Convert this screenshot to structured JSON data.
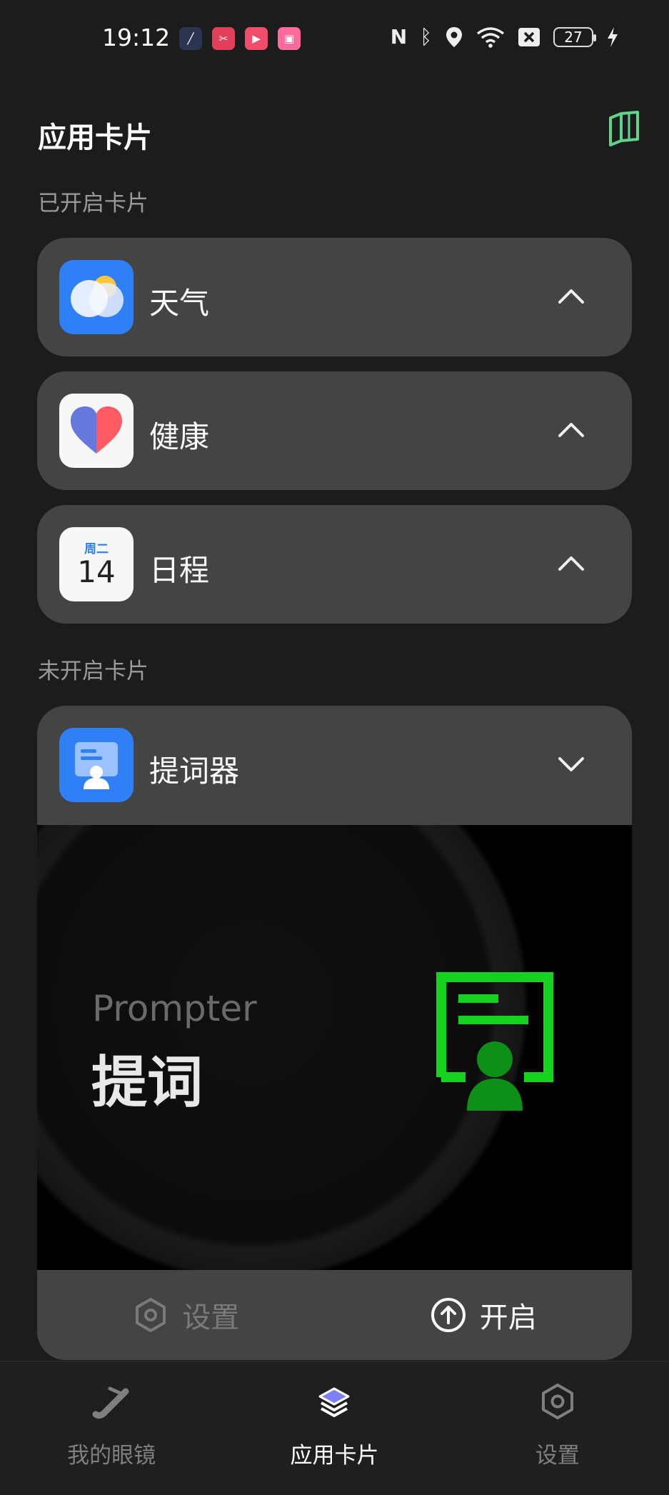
{
  "status_bar": {
    "time": "19:12",
    "battery": "27",
    "icons": [
      "nfc-icon",
      "bluetooth-icon",
      "location-icon",
      "wifi-icon",
      "sim-off-icon",
      "battery-icon",
      "charging-icon"
    ]
  },
  "header": {
    "title": "应用卡片",
    "action_icon": "book-open-icon",
    "accent": "#5fd48a"
  },
  "sections": {
    "enabled_label": "已开启卡片",
    "disabled_label": "未开启卡片"
  },
  "enabled_cards": [
    {
      "label": "天气",
      "icon": "weather-icon"
    },
    {
      "label": "健康",
      "icon": "health-heart-icon"
    },
    {
      "label": "日程",
      "icon": "calendar-icon",
      "calendar_weekday": "周二",
      "calendar_day": "14"
    }
  ],
  "disabled_card": {
    "label": "提词器",
    "icon": "prompter-icon",
    "preview": {
      "title_en": "Prompter",
      "title_cn": "提词",
      "graphic_color": "#14d21e"
    },
    "actions": {
      "settings_label": "设置",
      "enable_label": "开启"
    }
  },
  "bottom_nav": {
    "tabs": [
      {
        "label": "我的眼镜",
        "icon": "glasses-icon",
        "active": false
      },
      {
        "label": "应用卡片",
        "icon": "app-cards-icon",
        "active": true
      },
      {
        "label": "设置",
        "icon": "settings-hex-icon",
        "active": false
      }
    ]
  }
}
